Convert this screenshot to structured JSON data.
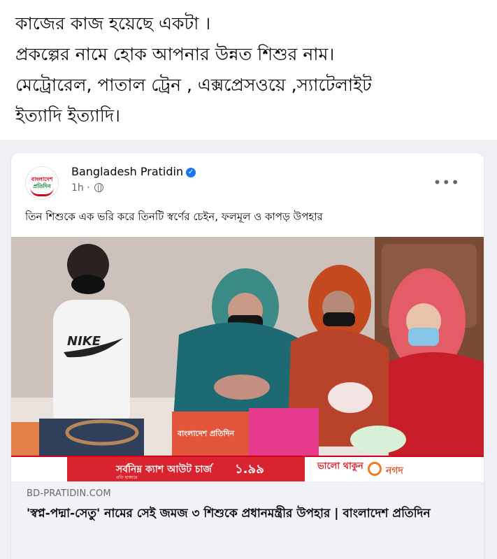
{
  "caption": {
    "lines": [
      "কাজের কাজ হয়েছে একটা ।",
      "প্রকল্পের নামে হোক আপনার উন্নত শিশুর নাম।",
      "মেট্রোরেল, পাতাল ট্রেন , এক্সপ্রেসওয়ে ,স্যাটেলাইট",
      "ইত্যাদি ইত্যাদি।"
    ]
  },
  "shared_post": {
    "page_name": "Bangladesh Pratidin",
    "time": "1h ·",
    "logo_top": "বাংলাদেশ",
    "logo_bottom": "প্রতিদিন",
    "text": "তিন শিশুকে এক ভরি করে তিনটি স্বর্ণের চেইন, ফলমূল ও কাপড় উপহার",
    "shirt_text": "NIKE",
    "bag_text": "বাংলাদেশ প্রতিদিন",
    "ad": {
      "main": "সর্বনিম্ন ক্যাশ আউট চার্জ",
      "price": "১.৯৯",
      "small": "প্রতি হাজারে",
      "brand1": "ভালো থাকুন",
      "brand2": "নগদ"
    },
    "link": {
      "domain": "BD-PRATIDIN.COM",
      "headline": "'স্বপ্ন-পদ্মা-সেতু' নামের সেই জমজ ৩ শিশুকে প্রধানমন্ত্রীর উপহার | বাংলাদেশ প্রতিদিন"
    }
  },
  "colors": {
    "verified": "#1877f2",
    "brand_red": "#d9232e",
    "link_bg": "#f0f2f5",
    "meta_gray": "#65676b"
  },
  "icons": [
    "verified-badge-icon",
    "globe-icon",
    "more-options-icon",
    "nagad-logo-icon"
  ]
}
